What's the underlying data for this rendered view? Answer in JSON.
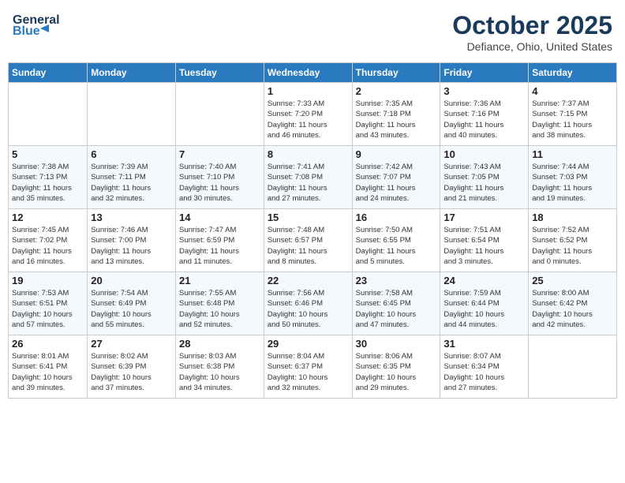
{
  "header": {
    "logo_line1": "General",
    "logo_line2": "Blue",
    "month": "October 2025",
    "location": "Defiance, Ohio, United States"
  },
  "days_of_week": [
    "Sunday",
    "Monday",
    "Tuesday",
    "Wednesday",
    "Thursday",
    "Friday",
    "Saturday"
  ],
  "weeks": [
    [
      {
        "num": "",
        "info": ""
      },
      {
        "num": "",
        "info": ""
      },
      {
        "num": "",
        "info": ""
      },
      {
        "num": "1",
        "info": "Sunrise: 7:33 AM\nSunset: 7:20 PM\nDaylight: 11 hours\nand 46 minutes."
      },
      {
        "num": "2",
        "info": "Sunrise: 7:35 AM\nSunset: 7:18 PM\nDaylight: 11 hours\nand 43 minutes."
      },
      {
        "num": "3",
        "info": "Sunrise: 7:36 AM\nSunset: 7:16 PM\nDaylight: 11 hours\nand 40 minutes."
      },
      {
        "num": "4",
        "info": "Sunrise: 7:37 AM\nSunset: 7:15 PM\nDaylight: 11 hours\nand 38 minutes."
      }
    ],
    [
      {
        "num": "5",
        "info": "Sunrise: 7:38 AM\nSunset: 7:13 PM\nDaylight: 11 hours\nand 35 minutes."
      },
      {
        "num": "6",
        "info": "Sunrise: 7:39 AM\nSunset: 7:11 PM\nDaylight: 11 hours\nand 32 minutes."
      },
      {
        "num": "7",
        "info": "Sunrise: 7:40 AM\nSunset: 7:10 PM\nDaylight: 11 hours\nand 30 minutes."
      },
      {
        "num": "8",
        "info": "Sunrise: 7:41 AM\nSunset: 7:08 PM\nDaylight: 11 hours\nand 27 minutes."
      },
      {
        "num": "9",
        "info": "Sunrise: 7:42 AM\nSunset: 7:07 PM\nDaylight: 11 hours\nand 24 minutes."
      },
      {
        "num": "10",
        "info": "Sunrise: 7:43 AM\nSunset: 7:05 PM\nDaylight: 11 hours\nand 21 minutes."
      },
      {
        "num": "11",
        "info": "Sunrise: 7:44 AM\nSunset: 7:03 PM\nDaylight: 11 hours\nand 19 minutes."
      }
    ],
    [
      {
        "num": "12",
        "info": "Sunrise: 7:45 AM\nSunset: 7:02 PM\nDaylight: 11 hours\nand 16 minutes."
      },
      {
        "num": "13",
        "info": "Sunrise: 7:46 AM\nSunset: 7:00 PM\nDaylight: 11 hours\nand 13 minutes."
      },
      {
        "num": "14",
        "info": "Sunrise: 7:47 AM\nSunset: 6:59 PM\nDaylight: 11 hours\nand 11 minutes."
      },
      {
        "num": "15",
        "info": "Sunrise: 7:48 AM\nSunset: 6:57 PM\nDaylight: 11 hours\nand 8 minutes."
      },
      {
        "num": "16",
        "info": "Sunrise: 7:50 AM\nSunset: 6:55 PM\nDaylight: 11 hours\nand 5 minutes."
      },
      {
        "num": "17",
        "info": "Sunrise: 7:51 AM\nSunset: 6:54 PM\nDaylight: 11 hours\nand 3 minutes."
      },
      {
        "num": "18",
        "info": "Sunrise: 7:52 AM\nSunset: 6:52 PM\nDaylight: 11 hours\nand 0 minutes."
      }
    ],
    [
      {
        "num": "19",
        "info": "Sunrise: 7:53 AM\nSunset: 6:51 PM\nDaylight: 10 hours\nand 57 minutes."
      },
      {
        "num": "20",
        "info": "Sunrise: 7:54 AM\nSunset: 6:49 PM\nDaylight: 10 hours\nand 55 minutes."
      },
      {
        "num": "21",
        "info": "Sunrise: 7:55 AM\nSunset: 6:48 PM\nDaylight: 10 hours\nand 52 minutes."
      },
      {
        "num": "22",
        "info": "Sunrise: 7:56 AM\nSunset: 6:46 PM\nDaylight: 10 hours\nand 50 minutes."
      },
      {
        "num": "23",
        "info": "Sunrise: 7:58 AM\nSunset: 6:45 PM\nDaylight: 10 hours\nand 47 minutes."
      },
      {
        "num": "24",
        "info": "Sunrise: 7:59 AM\nSunset: 6:44 PM\nDaylight: 10 hours\nand 44 minutes."
      },
      {
        "num": "25",
        "info": "Sunrise: 8:00 AM\nSunset: 6:42 PM\nDaylight: 10 hours\nand 42 minutes."
      }
    ],
    [
      {
        "num": "26",
        "info": "Sunrise: 8:01 AM\nSunset: 6:41 PM\nDaylight: 10 hours\nand 39 minutes."
      },
      {
        "num": "27",
        "info": "Sunrise: 8:02 AM\nSunset: 6:39 PM\nDaylight: 10 hours\nand 37 minutes."
      },
      {
        "num": "28",
        "info": "Sunrise: 8:03 AM\nSunset: 6:38 PM\nDaylight: 10 hours\nand 34 minutes."
      },
      {
        "num": "29",
        "info": "Sunrise: 8:04 AM\nSunset: 6:37 PM\nDaylight: 10 hours\nand 32 minutes."
      },
      {
        "num": "30",
        "info": "Sunrise: 8:06 AM\nSunset: 6:35 PM\nDaylight: 10 hours\nand 29 minutes."
      },
      {
        "num": "31",
        "info": "Sunrise: 8:07 AM\nSunset: 6:34 PM\nDaylight: 10 hours\nand 27 minutes."
      },
      {
        "num": "",
        "info": ""
      }
    ]
  ]
}
